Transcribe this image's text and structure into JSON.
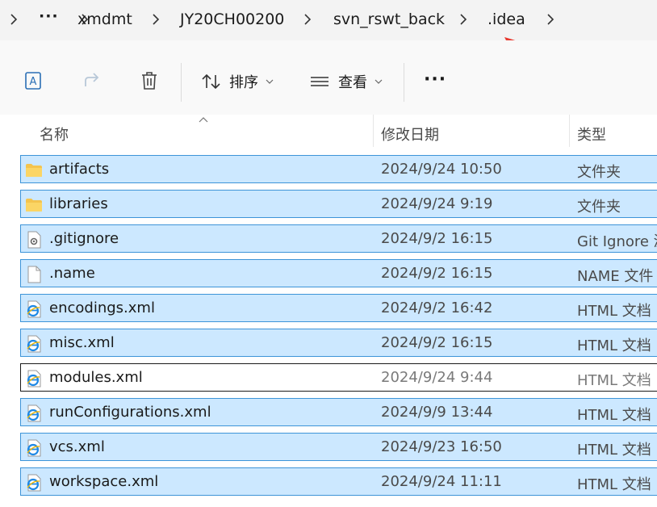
{
  "address": {
    "segments": [
      "xmdmt",
      "JY20CH00200",
      "svn_rswt_back",
      ".idea"
    ],
    "overflow": "···"
  },
  "toolbar": {
    "sort_label": "排序",
    "view_label": "查看",
    "more_label": "···"
  },
  "columns": {
    "name": "名称",
    "date": "修改日期",
    "type": "类型"
  },
  "files": [
    {
      "name": "artifacts",
      "date": "2024/9/24 10:50",
      "type": "文件夹",
      "icon": "folder-icon",
      "selected": true
    },
    {
      "name": "libraries",
      "date": "2024/9/24 9:19",
      "type": "文件夹",
      "icon": "folder-icon",
      "selected": true
    },
    {
      "name": ".gitignore",
      "date": "2024/9/2 16:15",
      "type": "Git Ignore 源",
      "icon": "settings-file-icon",
      "selected": true
    },
    {
      "name": ".name",
      "date": "2024/9/2 16:15",
      "type": "NAME 文件",
      "icon": "blank-file-icon",
      "selected": true
    },
    {
      "name": "encodings.xml",
      "date": "2024/9/2 16:42",
      "type": "HTML 文档",
      "icon": "html-file-icon",
      "selected": true
    },
    {
      "name": "misc.xml",
      "date": "2024/9/2 16:15",
      "type": "HTML 文档",
      "icon": "html-file-icon",
      "selected": true
    },
    {
      "name": "modules.xml",
      "date": "2024/9/24 9:44",
      "type": "HTML 文档",
      "icon": "html-file-icon",
      "selected": false
    },
    {
      "name": "runConfigurations.xml",
      "date": "2024/9/9 13:44",
      "type": "HTML 文档",
      "icon": "html-file-icon",
      "selected": true
    },
    {
      "name": "vcs.xml",
      "date": "2024/9/23 16:50",
      "type": "HTML 文档",
      "icon": "html-file-icon",
      "selected": true
    },
    {
      "name": "workspace.xml",
      "date": "2024/9/24 11:11",
      "type": "HTML 文档",
      "icon": "html-file-icon",
      "selected": true
    }
  ],
  "colors": {
    "selection_bg": "#cce8ff",
    "selection_border": "#3d94d8",
    "annotation_arrow": "#e8392f"
  }
}
